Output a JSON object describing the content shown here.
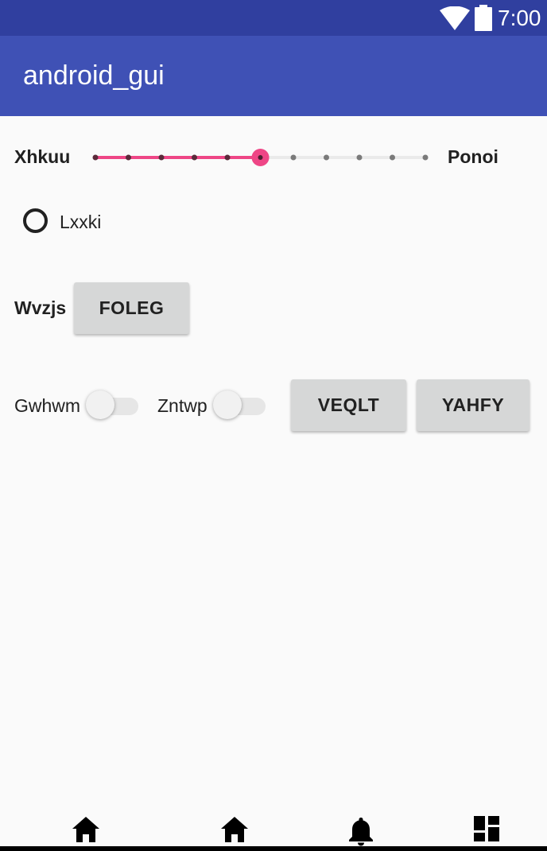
{
  "status_bar": {
    "time": "7:00",
    "icons": [
      "wifi-icon",
      "battery-icon"
    ],
    "background": "#303f9f"
  },
  "app_bar": {
    "title": "android_gui",
    "background": "#3f51b5"
  },
  "seekbar_row": {
    "left_label": "Xhkuu",
    "right_label": "Ponoi",
    "max": 10,
    "value": 5,
    "accent": "#ee4686"
  },
  "radio": {
    "label": "Lxxki",
    "checked": false
  },
  "button_row": {
    "label": "Wvzjs",
    "button": "FOLEG"
  },
  "switch_row": {
    "switch1_label": "Gwhwm",
    "switch1_on": false,
    "switch2_label": "Zntwp",
    "switch2_on": false,
    "button1": "VEQLT",
    "button2": "YAHFY"
  },
  "bottom_nav": {
    "icons": [
      "home-icon",
      "home-icon",
      "bell-icon",
      "dashboard-icon"
    ]
  }
}
